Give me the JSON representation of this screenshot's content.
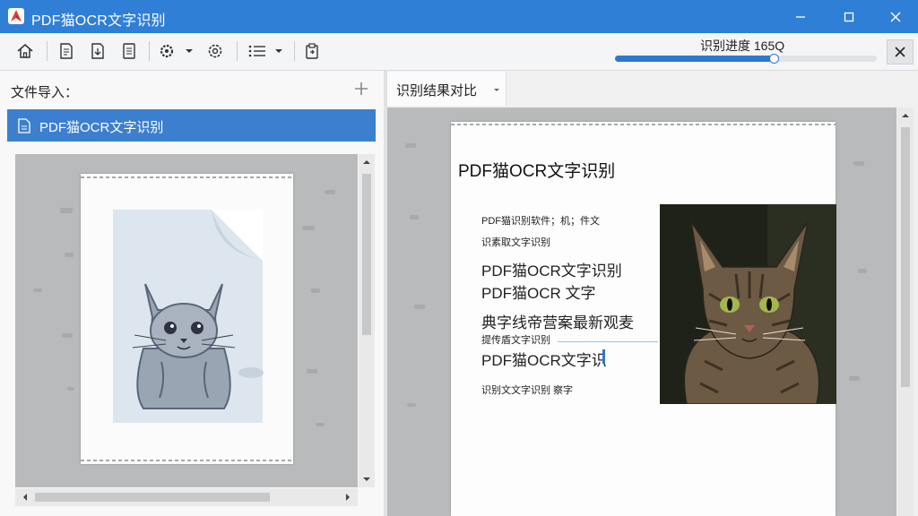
{
  "app": {
    "title": "PDF猫OCR文字识别"
  },
  "window_controls": {
    "minimize": "minimize-icon",
    "maximize": "maximize-icon",
    "close": "close-icon"
  },
  "toolbar": {
    "icons": [
      "home-icon",
      "pages-icon",
      "export-icon",
      "document-icon",
      "settings-dropdown-icon",
      "gear-icon",
      "list-dropdown-icon",
      "clipboard-icon"
    ]
  },
  "progress": {
    "label": "识别进度 165Q",
    "bar1_value": 0.6,
    "bar2_value": 0.73
  },
  "left": {
    "import_label": "文件导入：",
    "file_item": "PDF猫OCR文字识别"
  },
  "right": {
    "tab_label": "识别结果对比",
    "ocr_title": "PDF猫OCR文字识别",
    "lines": [
      "PDF猫识别软件；机；件文",
      "识素取文字识别",
      "PDF猫OCR文字识别",
      "PDF猫OCR 文字",
      "典字线帝营案最新观麦",
      "提传盾文字识别",
      "PDF猫OCR文字识",
      "识别文文字识别 察字"
    ]
  },
  "colors": {
    "titlebar": "#2f7fd6",
    "accent": "#3d7fcf",
    "progress": "#2d78d0"
  }
}
